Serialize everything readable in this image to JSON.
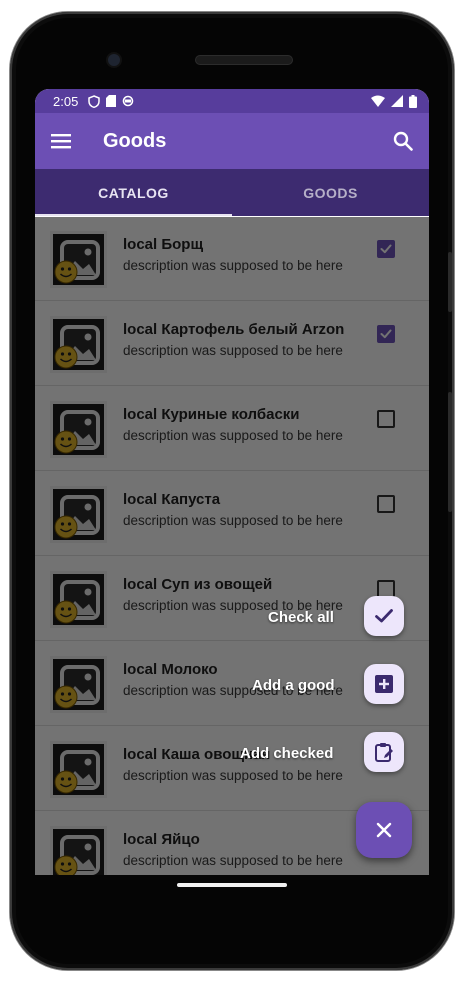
{
  "status_bar": {
    "time": "2:05"
  },
  "toolbar": {
    "title": "Goods"
  },
  "tabs": [
    {
      "label": "CATALOG",
      "active": true
    },
    {
      "label": "GOODS",
      "active": false
    }
  ],
  "items": [
    {
      "name": "local Борщ",
      "description": "description was supposed to be here",
      "checked": true
    },
    {
      "name": "local Картофель белый Arzon",
      "description": "description was supposed to be here",
      "checked": true
    },
    {
      "name": "local Куриные колбаски",
      "description": "description was supposed to be here",
      "checked": false
    },
    {
      "name": "local Капуста",
      "description": "description was supposed to be here",
      "checked": false
    },
    {
      "name": "local Суп из овощей",
      "description": "description was supposed to be here",
      "checked": false
    },
    {
      "name": "local Молоко",
      "description": "description was supposed to be here",
      "checked": false
    },
    {
      "name": "local Каша овощная",
      "description": "description was supposed to be here",
      "checked": false
    },
    {
      "name": "local Яйцо",
      "description": "description was supposed to be here",
      "checked": false
    }
  ],
  "fab_menu": {
    "check_all_label": "Check all",
    "add_good_label": "Add a good",
    "add_checked_label": "Add checked"
  },
  "icons": {
    "menu": "menu-icon",
    "search": "search-icon",
    "check_all": "check-icon",
    "add_good": "add-box-icon",
    "add_checked": "clipboard-edit-icon",
    "close": "close-icon"
  },
  "colors": {
    "primary": "#6c4fb4",
    "primary_dark": "#573d9c",
    "tab_bar": "#3d2b70",
    "mini_fab_bg": "#ede6fb",
    "fab_icon": "#3b2a6e"
  }
}
